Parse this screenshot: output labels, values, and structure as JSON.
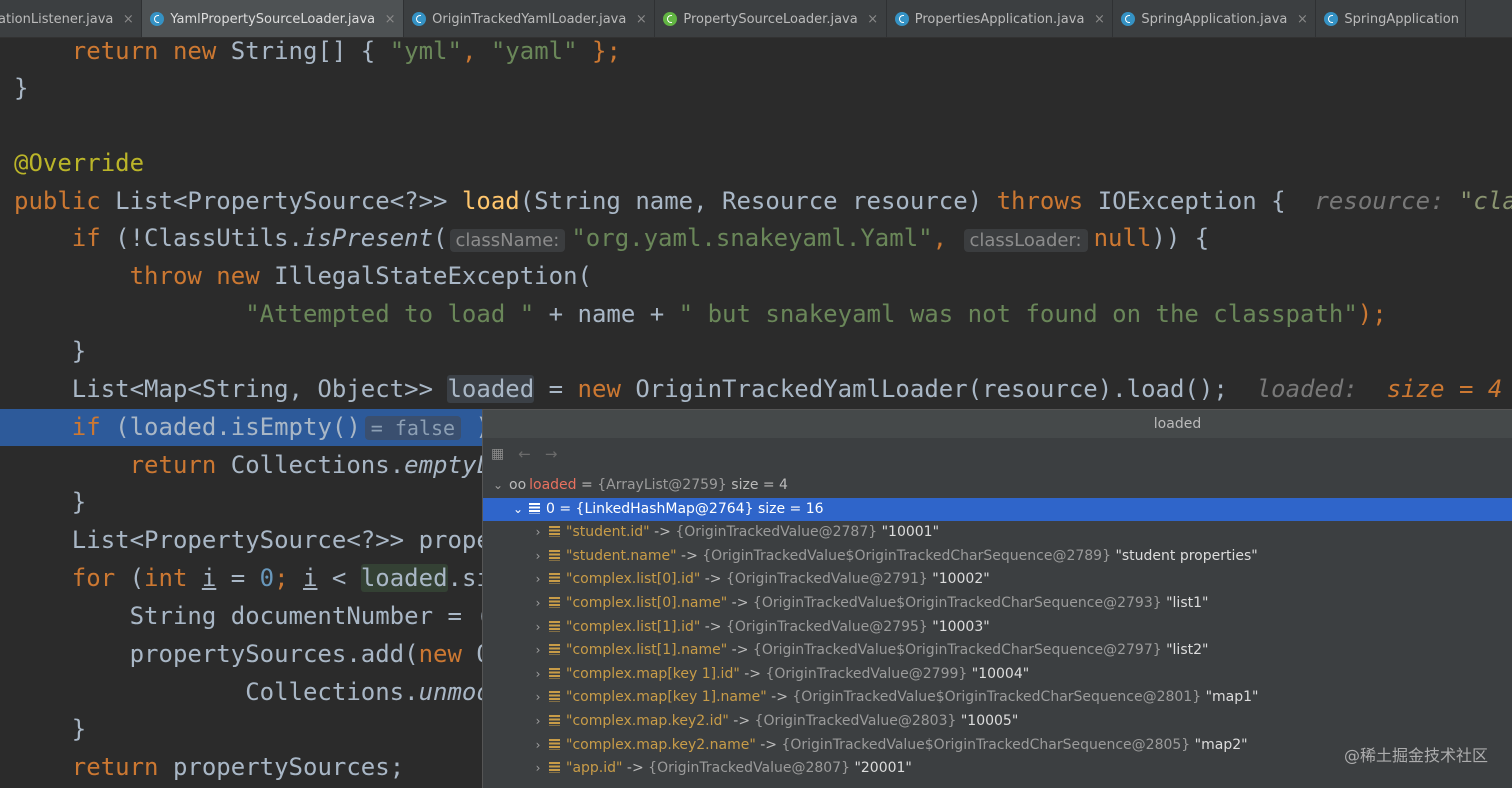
{
  "tabs": [
    {
      "label": "ationListener.java",
      "icon": "none",
      "active": false
    },
    {
      "label": "YamlPropertySourceLoader.java",
      "icon": "class-icon",
      "active": true
    },
    {
      "label": "OriginTrackedYamlLoader.java",
      "icon": "class-icon",
      "active": false
    },
    {
      "label": "PropertySourceLoader.java",
      "icon": "interface-icon",
      "active": false
    },
    {
      "label": "PropertiesApplication.java",
      "icon": "class-icon",
      "active": false
    },
    {
      "label": "SpringApplication.java",
      "icon": "class-icon",
      "active": false
    },
    {
      "label": "SpringApplication",
      "icon": "class-icon",
      "active": false
    }
  ],
  "tab_close_glyph": "×",
  "code": {
    "l1": [
      "return",
      " new ",
      "String[] { ",
      "\"yml\"",
      ", ",
      "\"yaml\"",
      " };"
    ],
    "l2": "}",
    "l4": "@Override",
    "l5": [
      "public ",
      "List<PropertySource<?>> ",
      "load",
      "(String name, Resource resource) ",
      "throws ",
      "IOException {",
      "resource: ",
      "\"class"
    ],
    "l6": [
      "if ",
      "(!ClassUtils.",
      "isPresent",
      "(",
      "className:",
      "\"org.yaml.snakeyaml.Yaml\"",
      ",",
      "classLoader:",
      "null",
      ")) {"
    ],
    "l7": [
      "throw new ",
      "IllegalStateException("
    ],
    "l8": [
      "\"Attempted to load \"",
      " + name + ",
      "\" but snakeyaml was not found on the classpath\"",
      ");"
    ],
    "l9": "}",
    "l10": [
      "List<Map<String, Object>> ",
      "loaded",
      " = ",
      "new ",
      "OriginTrackedYamlLoader(resource).load();",
      "loaded:",
      "size = 4",
      "r"
    ],
    "l11": [
      "if ",
      "(loaded.isEmpty()",
      "= false",
      ")"
    ],
    "l12": [
      "return ",
      "Collections.",
      "emptyL"
    ],
    "l13": "}",
    "l14": "List<PropertySource<?>> prope",
    "l15": [
      "for ",
      "(",
      "int ",
      "i",
      " = ",
      "0",
      "; ",
      "i",
      " < ",
      "loaded",
      ".si"
    ],
    "l16": "String documentNumber = (",
    "l17": [
      "propertySources.add(",
      "new ",
      "O"
    ],
    "l18": [
      "Collections.",
      "unmod"
    ],
    "l19": "}",
    "l20": [
      "return ",
      "propertySources;"
    ]
  },
  "debug_popup": {
    "title": "loaded",
    "root": {
      "name": "loaded",
      "eq": " = ",
      "type": "{ArrayList@2759}",
      "size": "size = 4"
    },
    "selected": {
      "label": "0 = {LinkedHashMap@2764}",
      "size": "size = 16"
    },
    "entries": [
      {
        "key": "\"student.id\"",
        "arrow": " -> ",
        "type": "{OriginTrackedValue@2787}",
        "value": "\"10001\""
      },
      {
        "key": "\"student.name\"",
        "arrow": " -> ",
        "type": "{OriginTrackedValue$OriginTrackedCharSequence@2789}",
        "value": "\"student properties\""
      },
      {
        "key": "\"complex.list[0].id\"",
        "arrow": " -> ",
        "type": "{OriginTrackedValue@2791}",
        "value": "\"10002\""
      },
      {
        "key": "\"complex.list[0].name\"",
        "arrow": " -> ",
        "type": "{OriginTrackedValue$OriginTrackedCharSequence@2793}",
        "value": "\"list1\""
      },
      {
        "key": "\"complex.list[1].id\"",
        "arrow": " -> ",
        "type": "{OriginTrackedValue@2795}",
        "value": "\"10003\""
      },
      {
        "key": "\"complex.list[1].name\"",
        "arrow": " -> ",
        "type": "{OriginTrackedValue$OriginTrackedCharSequence@2797}",
        "value": "\"list2\""
      },
      {
        "key": "\"complex.map[key 1].id\"",
        "arrow": " -> ",
        "type": "{OriginTrackedValue@2799}",
        "value": "\"10004\""
      },
      {
        "key": "\"complex.map[key 1].name\"",
        "arrow": " -> ",
        "type": "{OriginTrackedValue$OriginTrackedCharSequence@2801}",
        "value": "\"map1\""
      },
      {
        "key": "\"complex.map.key2.id\"",
        "arrow": " -> ",
        "type": "{OriginTrackedValue@2803}",
        "value": "\"10005\""
      },
      {
        "key": "\"complex.map.key2.name\"",
        "arrow": " -> ",
        "type": "{OriginTrackedValue$OriginTrackedCharSequence@2805}",
        "value": "\"map2\""
      },
      {
        "key": "\"app.id\"",
        "arrow": " -> ",
        "type": "{OriginTrackedValue@2807}",
        "value": "\"20001\""
      }
    ]
  },
  "watermark": "@稀土掘金技术社区",
  "colors": {
    "keyword": "#cc7832",
    "string": "#6a8759",
    "annotation": "#bbb529",
    "method": "#ffc66d",
    "number": "#6897bb",
    "execution_line": "#2d5a9a",
    "selected_row": "#2f65ca"
  }
}
